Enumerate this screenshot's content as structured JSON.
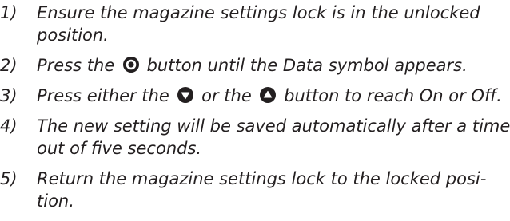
{
  "steps": [
    {
      "number": "1)",
      "lines": [
        "Ensure the magazine settings lock is in the unlocked",
        "position."
      ]
    },
    {
      "number": "2)",
      "before": "Press the",
      "icon": "select-circle-icon",
      "after": "button until the Data symbol appears."
    },
    {
      "number": "3)",
      "p1": "Press either the",
      "icon1": "down-arrow-icon",
      "p2": "or the",
      "icon2": "up-arrow-icon",
      "p3": "button to reach On or Off."
    },
    {
      "number": "4)",
      "lines": [
        "The new setting will be saved automatically after a time",
        "out of five seconds."
      ]
    },
    {
      "number": "5)",
      "lines": [
        "Return the magazine settings lock to the locked posi-",
        "tion."
      ]
    }
  ]
}
